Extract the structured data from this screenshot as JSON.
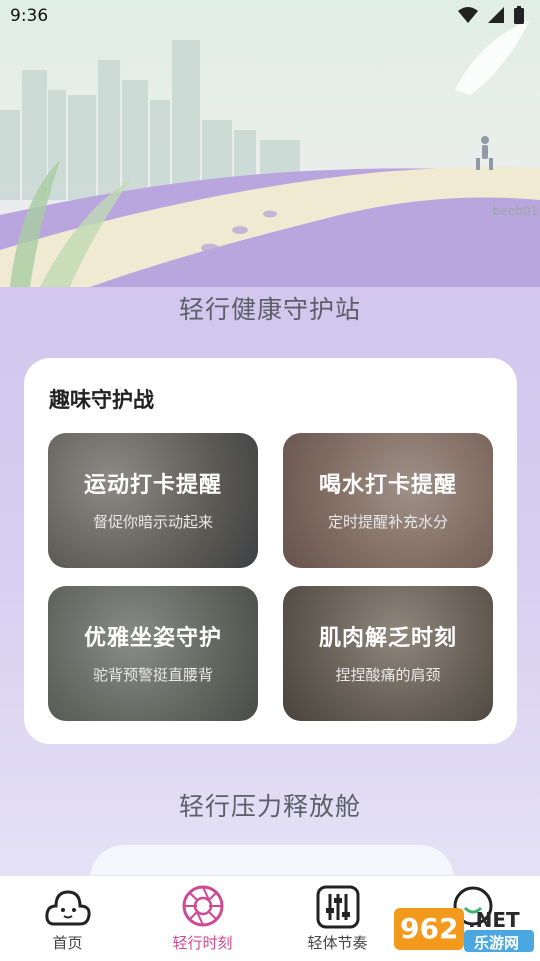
{
  "status": {
    "time": "9:36"
  },
  "hero": {
    "watermark": "beeb01"
  },
  "sections": {
    "guard_station": "轻行健康守护站",
    "stress_release": "轻行压力释放舱"
  },
  "fun_card": {
    "title": "趣味守护战",
    "tiles": [
      {
        "title": "运动打卡提醒",
        "subtitle": "督促你暗示动起来"
      },
      {
        "title": "喝水打卡提醒",
        "subtitle": "定时提醒补充水分"
      },
      {
        "title": "优雅坐姿守护",
        "subtitle": "驼背预警挺直腰背"
      },
      {
        "title": "肌肉解乏时刻",
        "subtitle": "捏捏酸痛的肩颈"
      }
    ]
  },
  "tabbar": {
    "items": [
      {
        "label": "首页",
        "icon": "cloud-face-icon"
      },
      {
        "label": "轻行时刻",
        "icon": "aperture-icon"
      },
      {
        "label": "轻体节奏",
        "icon": "equalizer-icon"
      },
      {
        "label": "",
        "icon": "smile-icon"
      }
    ],
    "active_color": "#d04a93"
  },
  "brand_overlay": {
    "number": "962",
    "suffix": ".NET",
    "name": "乐游网"
  }
}
